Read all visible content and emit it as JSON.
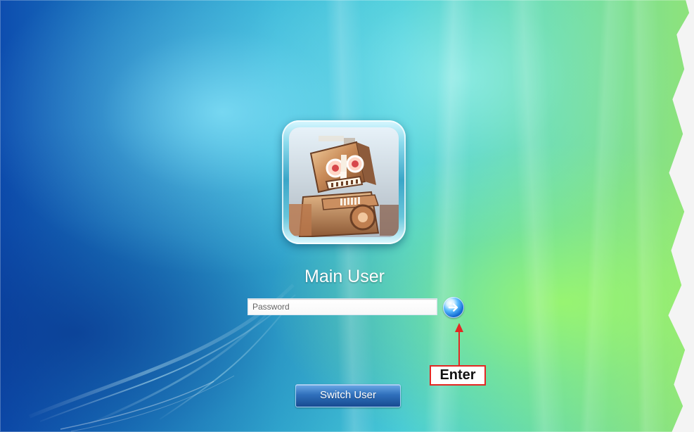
{
  "login": {
    "username": "Main User",
    "password_placeholder": "Password"
  },
  "actions": {
    "switch_user_label": "Switch User"
  },
  "callout": {
    "label": "Enter"
  },
  "icons": {
    "avatar": "robot-avatar-icon",
    "submit": "arrow-right-icon"
  },
  "colors": {
    "callout_border": "#e32722",
    "username_text": "#ffffff"
  }
}
